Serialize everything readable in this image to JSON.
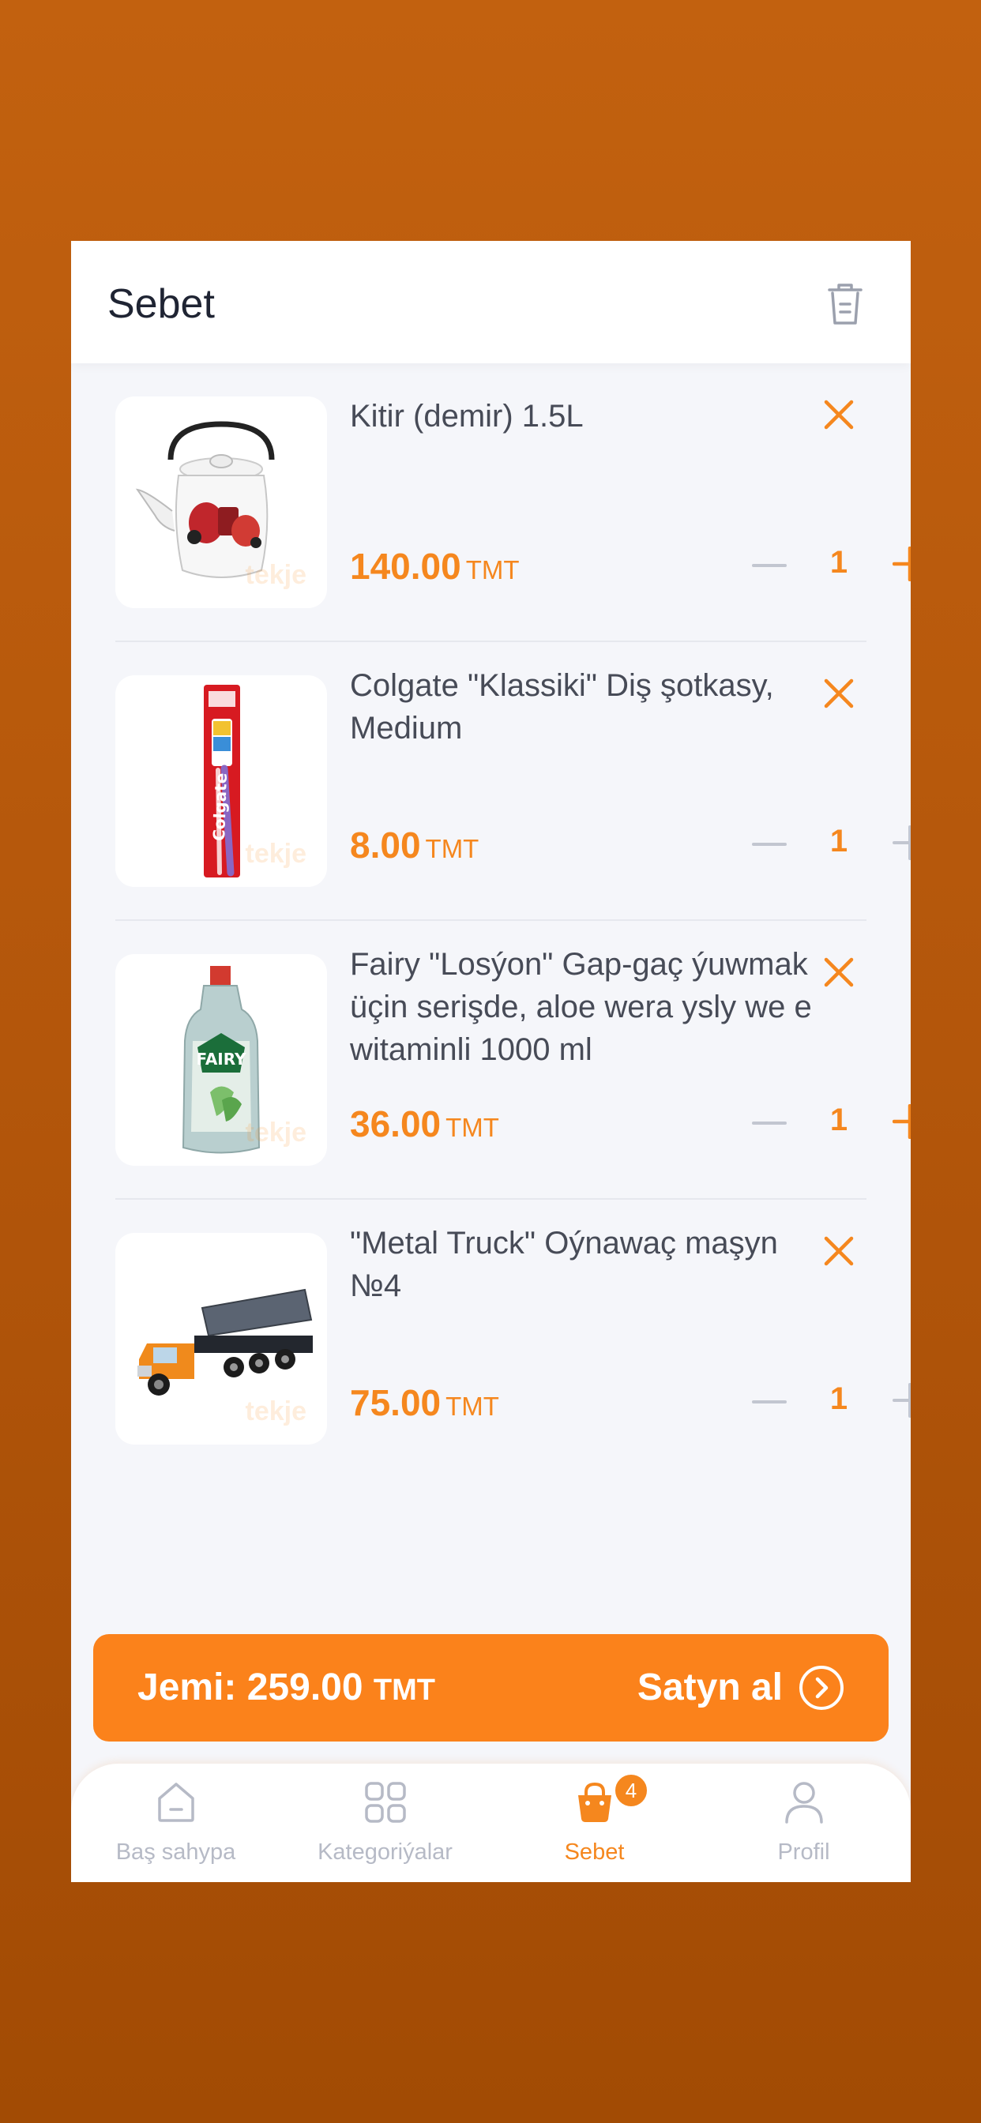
{
  "header": {
    "title": "Sebet"
  },
  "cart": {
    "items": [
      {
        "name": "Kitir (demir) 1.5L",
        "price": "140.00",
        "currency": "TMT",
        "qty": "1",
        "watermark": "tekje",
        "image": "kettle"
      },
      {
        "name": "Colgate \"Klassiki\" Diş şotkasy, Medium",
        "price": "8.00",
        "currency": "TMT",
        "qty": "1",
        "watermark": "tekje",
        "image": "toothbrush"
      },
      {
        "name": "Fairy \"Losýon\" Gap-gaç ýuwmak üçin serişde, aloe wera ysly we e witaminli 1000 ml",
        "price": "36.00",
        "currency": "TMT",
        "qty": "1",
        "watermark": "tekje",
        "image": "detergent-bottle"
      },
      {
        "name": "\"Metal Truck\" Oýnawaç maşyn №4",
        "price": "75.00",
        "currency": "TMT",
        "qty": "1",
        "watermark": "tekje",
        "image": "toy-truck"
      }
    ],
    "image_text": {
      "brand_1": "Colgate",
      "brand_2": "FAIRY"
    }
  },
  "checkout": {
    "total_label": "Jemi:",
    "total": "259.00",
    "currency": "TMT",
    "buy_label": "Satyn al"
  },
  "tabbar": {
    "tabs": [
      {
        "label": "Baş sahypa",
        "icon": "home-icon"
      },
      {
        "label": "Kategoriýalar",
        "icon": "grid-icon"
      },
      {
        "label": "Sebet",
        "icon": "basket-icon",
        "badge": "4"
      },
      {
        "label": "Profil",
        "icon": "user-icon"
      }
    ]
  },
  "colors": {
    "accent": "#f5871e",
    "background": "#f5f6fa",
    "text": "#474b57"
  }
}
